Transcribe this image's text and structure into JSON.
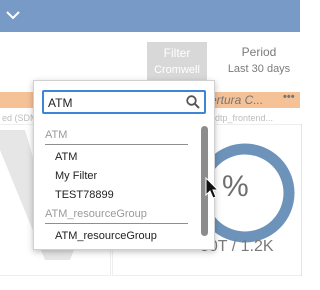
{
  "header": {
    "filter_label": "Filter",
    "filter_value": "Cromwell",
    "period_label": "Period",
    "period_value": "Last 30 days"
  },
  "panel": {
    "title": "ertura C...",
    "more_label": "•••",
    "left_sub_label": "ed (SDM",
    "right_sub_label": "_dtp_frontend...",
    "percent": "%",
    "ratio": "80T / 1.2K"
  },
  "dropdown": {
    "search_value": "ATM",
    "groups": [
      {
        "label": "ATM",
        "options": [
          "ATM",
          "My Filter",
          "TEST78899"
        ]
      },
      {
        "label": "ATM_resourceGroup",
        "options": [
          "ATM_resourceGroup"
        ]
      }
    ]
  },
  "colors": {
    "banner": "#2f66a8",
    "panel_header": "#f0a060",
    "search_focus": "#3d86d5",
    "gauge_arc": "#1f5a96",
    "filter_button": "#c4c4c4"
  }
}
